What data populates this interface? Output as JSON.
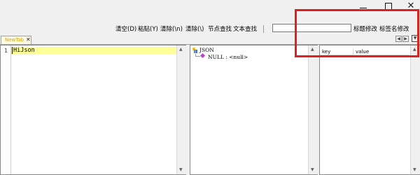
{
  "window": {
    "controls": {
      "minimize_icon": "minimize-icon",
      "maximize_icon": "maximize-icon",
      "close_icon": "close-icon",
      "close_glyph": "✕"
    }
  },
  "toolbar": {
    "clear": "清空(D)",
    "paste": "粘贴(Y)",
    "remove_newlines": "清除(\\n)",
    "remove_backslashes": "清除(\\)",
    "node_search": "节点查找",
    "text_search": "文本查找",
    "search_value": "",
    "title_edit": "标题修改",
    "tab_name_edit": "标签名修改"
  },
  "tabs": [
    {
      "label": "NewTab",
      "close_glyph": "✕",
      "color": "#e0a000"
    }
  ],
  "tab_scroll": {
    "left": "◀",
    "right": "▶",
    "menu": "▼"
  },
  "editor": {
    "lines": [
      {
        "number": "1",
        "text": "HiJson"
      }
    ],
    "highlight_color": "#ffff9a"
  },
  "tree": {
    "root": "JSON",
    "children": [
      {
        "label": "NULL : <null>"
      }
    ]
  },
  "table": {
    "columns": [
      "key",
      "value"
    ]
  },
  "annotation": {
    "color": "#e02020"
  }
}
